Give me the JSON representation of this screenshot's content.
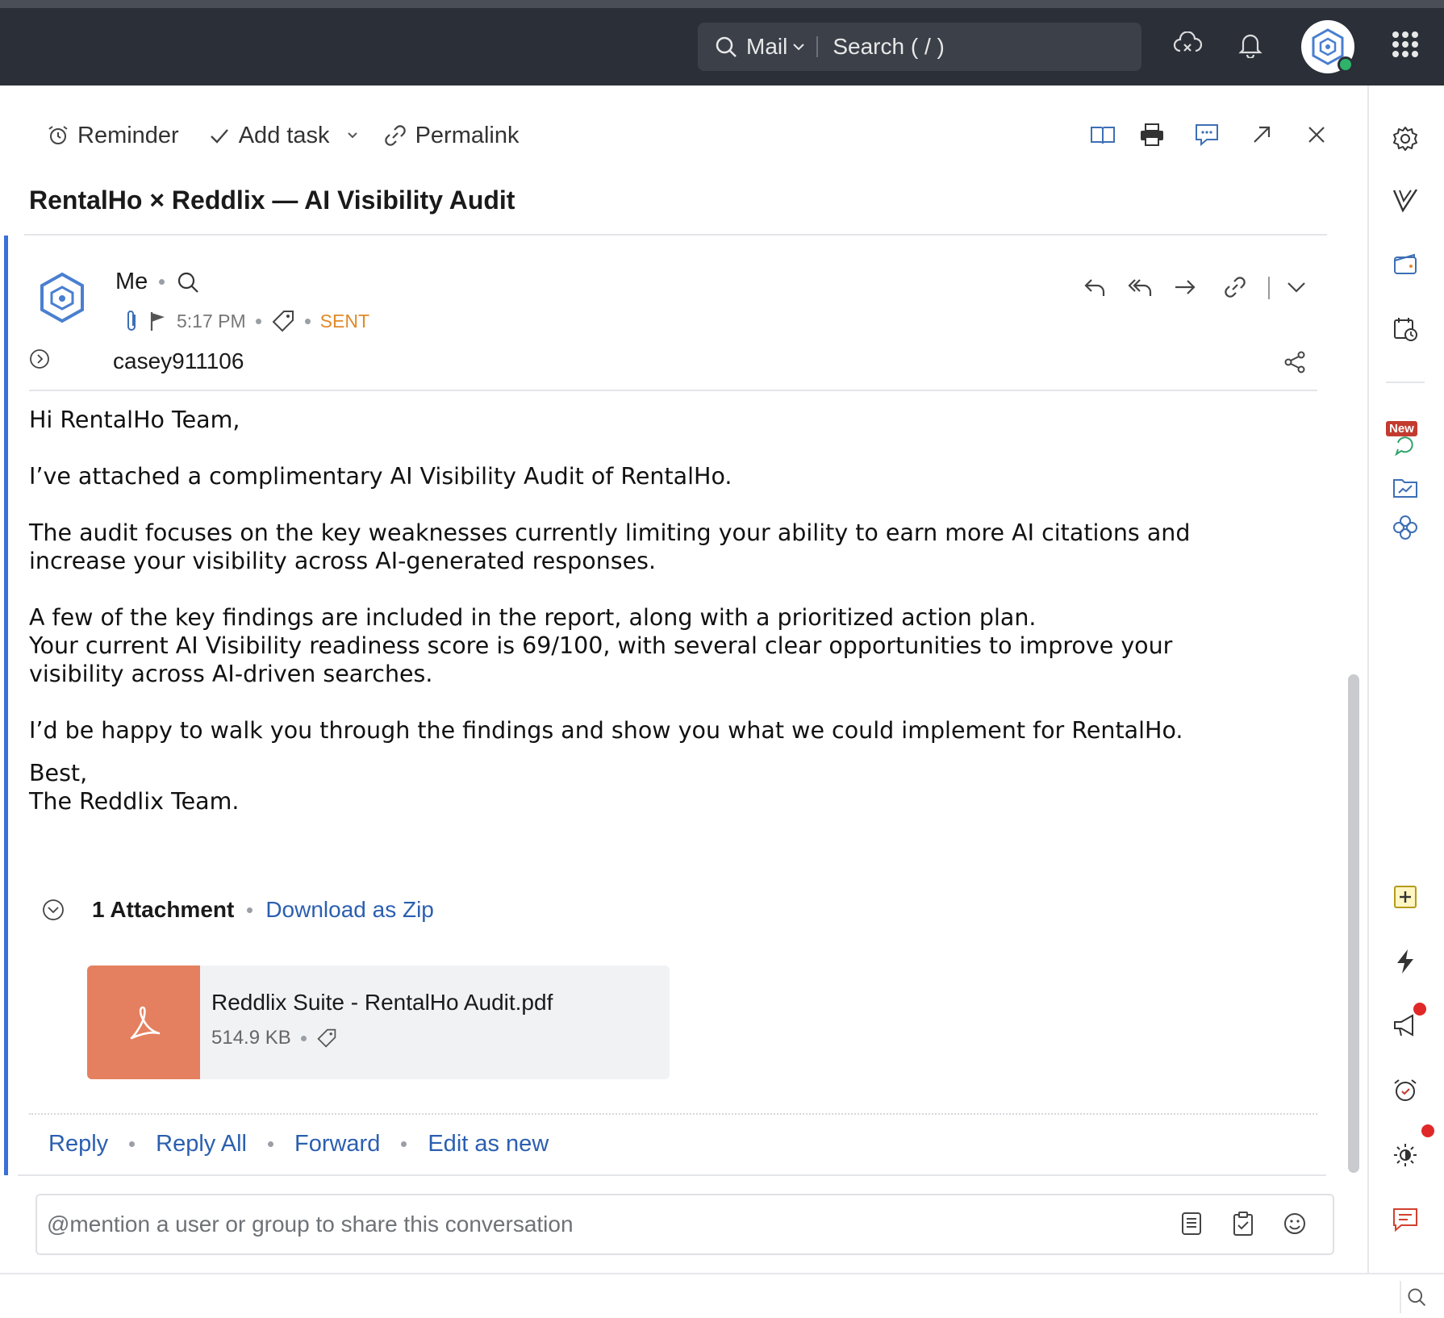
{
  "topbar": {
    "search_scope": "Mail",
    "search_placeholder": "Search ( / )"
  },
  "toolbar": {
    "reminder_label": "Reminder",
    "add_task_label": "Add task",
    "permalink_label": "Permalink"
  },
  "email": {
    "subject": "RentalHo × Reddlix — AI Visibility Audit",
    "sender": "Me",
    "time": "5:17 PM",
    "status": "SENT",
    "recipient": "casey911106",
    "body": [
      "Hi RentalHo Team,",
      "I’ve attached a complimentary AI Visibility Audit of RentalHo.",
      "The audit focuses on the key weaknesses currently limiting your ability to earn more AI citations and\nincrease your visibility across AI-generated responses.",
      "A few of the key findings are included in the report, along with a prioritized action plan.\nYour current AI Visibility readiness score is 69/100, with several clear opportunities to improve your\nvisibility across AI-driven searches.",
      "I’d be happy to walk you through the findings and show you what we could implement for RentalHo.",
      "Best,\nThe Reddlix Team."
    ]
  },
  "attachments": {
    "count_label": "1 Attachment",
    "download_zip_label": "Download as Zip",
    "file_name": "Reddlix Suite - RentalHo Audit.pdf",
    "file_size": "514.9 KB"
  },
  "reply_actions": {
    "reply": "Reply",
    "reply_all": "Reply All",
    "forward": "Forward",
    "edit_as_new": "Edit as new"
  },
  "comment": {
    "placeholder": "@mention a user or group to share this conversation"
  },
  "rail": {
    "new_badge": "New"
  },
  "colors": {
    "topbar": "#2a2f38",
    "link": "#2b5fb0",
    "sent": "#e08a2a",
    "accent": "#3b6fd8",
    "pdf": "#e4805f"
  }
}
